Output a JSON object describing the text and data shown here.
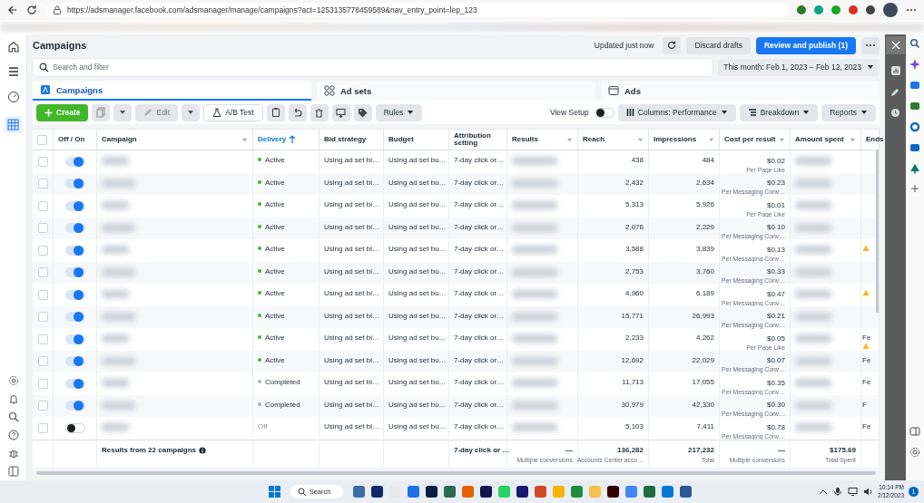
{
  "browser": {
    "url": "https://adsmanager.facebook.com/adsmanager/manage/campaigns?act=1253135778459589&nav_entry_point=lep_123"
  },
  "header": {
    "title": "Campaigns",
    "status": "Updated just now",
    "discard": "Discard drafts",
    "publish": "Review and publish (1)"
  },
  "search": {
    "placeholder": "Search and filter"
  },
  "date_range": "This month: Feb 1, 2023 – Feb 12, 2023",
  "tabs": [
    {
      "label": "Campaigns",
      "selected": true
    },
    {
      "label": "Ad sets",
      "selected": false
    },
    {
      "label": "Ads",
      "selected": false
    }
  ],
  "toolbar": {
    "create": {
      "label": "Create"
    },
    "edit": {
      "label": "Edit",
      "disabled": true
    },
    "ab_test": {
      "label": "A/B Test"
    },
    "rules": {
      "label": "Rules"
    },
    "view_setup": {
      "label": "View Setup",
      "on": false
    },
    "columns": {
      "label": "Columns: Performance"
    },
    "breakdown": {
      "label": "Breakdown"
    },
    "reports": {
      "label": "Reports"
    }
  },
  "table": {
    "select_all": {
      "checked": false
    },
    "columns": [
      {
        "label": "Off / On",
        "sorted": false,
        "menu": false
      },
      {
        "label": "Campaign",
        "sorted": false,
        "menu": true
      },
      {
        "label": "Delivery",
        "sorted": true,
        "menu": false
      },
      {
        "label": "Bid strategy",
        "sorted": false,
        "menu": false
      },
      {
        "label": "Budget",
        "sorted": false,
        "menu": false
      },
      {
        "label": "Attribution setting",
        "sorted": false,
        "menu": false
      },
      {
        "label": "Results",
        "sorted": false,
        "menu": true
      },
      {
        "label": "Reach",
        "sorted": false,
        "menu": true
      },
      {
        "label": "Impressions",
        "sorted": false,
        "menu": true
      },
      {
        "label": "Cost per result",
        "sorted": false,
        "menu": true
      },
      {
        "label": "Amount spent",
        "sorted": false,
        "menu": true
      },
      {
        "label": "Ends",
        "sorted": false
      }
    ],
    "rows": [
      {
        "checked": false,
        "on": true,
        "color": "#42b72a",
        "delivery": "Active",
        "bid": "Using ad set bi…",
        "budget": "Using ad set bu…",
        "attribution": "7-day click or…",
        "reach": "438",
        "impressions": "484",
        "cost": "$0.02",
        "cost_label": "Per Page Like",
        "warning": false
      },
      {
        "checked": false,
        "on": true,
        "color": "#42b72a",
        "delivery": "Active",
        "bid": "Using ad set bi…",
        "budget": "Using ad set bu…",
        "attribution": "7-day click or…",
        "reach": "2,432",
        "impressions": "2,634",
        "cost": "$0.23",
        "cost_label": "Per Messaging Conv…",
        "warning": false
      },
      {
        "checked": false,
        "on": true,
        "color": "#42b72a",
        "delivery": "Active",
        "bid": "Using ad set bi…",
        "budget": "Using ad set bu…",
        "attribution": "7-day click or…",
        "reach": "5,313",
        "impressions": "5,926",
        "cost": "$0.01",
        "cost_label": "Per Page Like",
        "warning": false
      },
      {
        "checked": false,
        "on": true,
        "color": "#42b72a",
        "delivery": "Active",
        "bid": "Using ad set bi…",
        "budget": "Using ad set bu…",
        "attribution": "7-day click or…",
        "reach": "2,076",
        "impressions": "2,229",
        "cost": "$0.10",
        "cost_label": "Per Messaging Conv…",
        "warning": false
      },
      {
        "checked": false,
        "on": true,
        "color": "#42b72a",
        "delivery": "Active",
        "bid": "Using ad set bi…",
        "budget": "Using ad set bu…",
        "attribution": "7-day click or…",
        "reach": "3,588",
        "impressions": "3,839",
        "cost": "$0.13",
        "cost_label": "Per Messaging Conv…",
        "warning": true
      },
      {
        "checked": false,
        "on": true,
        "color": "#42b72a",
        "delivery": "Active",
        "bid": "Using ad set bi…",
        "budget": "Using ad set bu…",
        "attribution": "7-day click or…",
        "reach": "2,753",
        "impressions": "3,760",
        "cost": "$0.33",
        "cost_label": "Per Messaging Conv…",
        "warning": false
      },
      {
        "checked": false,
        "on": true,
        "color": "#42b72a",
        "delivery": "Active",
        "bid": "Using ad set bi…",
        "budget": "Using ad set bu…",
        "attribution": "7-day click or…",
        "reach": "4,960",
        "impressions": "6,189",
        "cost": "$0.47",
        "cost_label": "Per Messaging Conv…",
        "warning": true
      },
      {
        "checked": false,
        "on": true,
        "color": "#42b72a",
        "delivery": "Active",
        "bid": "Using ad set bi…",
        "budget": "Using ad set bu…",
        "attribution": "7-day click or…",
        "reach": "15,771",
        "impressions": "26,993",
        "cost": "$0.21",
        "cost_label": "Per Messaging Conv…",
        "warning": false
      },
      {
        "checked": false,
        "on": true,
        "color": "#42b72a",
        "delivery": "Active",
        "bid": "Using ad set bi…",
        "budget": "Using ad set bu…",
        "attribution": "7-day click or…",
        "reach": "2,233",
        "impressions": "4,262",
        "cost": "$0.05",
        "cost_label": "Per Page Like",
        "ends": "Fe",
        "warning": true
      },
      {
        "checked": false,
        "on": true,
        "color": "#42b72a",
        "delivery": "Active",
        "bid": "Using ad set bi…",
        "budget": "Using ad set bu…",
        "attribution": "7-day click or…",
        "reach": "12,692",
        "impressions": "22,029",
        "cost": "$0.07",
        "cost_label": "Per Messaging Conv…",
        "ends": "Fe",
        "warning": false
      },
      {
        "checked": false,
        "on": true,
        "color": "#aab0b7",
        "delivery": "Completed",
        "bid": "Using ad set bi…",
        "budget": "Using ad set bu…",
        "attribution": "7-day click or…",
        "reach": "11,713",
        "impressions": "17,055",
        "cost": "$0.35",
        "cost_label": "Per Messaging Conv…",
        "ends": "Fe",
        "warning": false
      },
      {
        "checked": false,
        "on": true,
        "color": "#aab0b7",
        "delivery": "Completed",
        "bid": "Using ad set bi…",
        "budget": "Using ad set bu…",
        "attribution": "7-day click or…",
        "reach": "30,979",
        "impressions": "42,330",
        "cost": "$0.30",
        "cost_label": "Per Messaging Conv…",
        "ends": "F",
        "warning": false
      },
      {
        "checked": false,
        "on": false,
        "delivery": "Off",
        "bid": "Using ad set bi…",
        "budget": "Using ad set bu…",
        "attribution": "7-day click or…",
        "reach": "5,103",
        "impressions": "7,411",
        "cost": "$0.78",
        "cost_label": "Per Messaging Conv…",
        "ends": "Fe",
        "warning": false
      }
    ],
    "footer": {
      "label": "Results from 22 campaigns",
      "attribution": "7-day click or …",
      "results": "—",
      "results_sub": "Multiple conversions",
      "reach": "136,282",
      "reach_sub": "Accounts Center acco…",
      "impressions": "217,232",
      "impressions_sub": "Total",
      "cost": "—",
      "cost_sub": "Multiple conversions",
      "amount": "$175.69",
      "amount_sub": "Total Spent"
    }
  },
  "taskbar": {
    "search": "Search",
    "time": "10:14 PM",
    "date": "2/12/2023",
    "badge": "1"
  }
}
